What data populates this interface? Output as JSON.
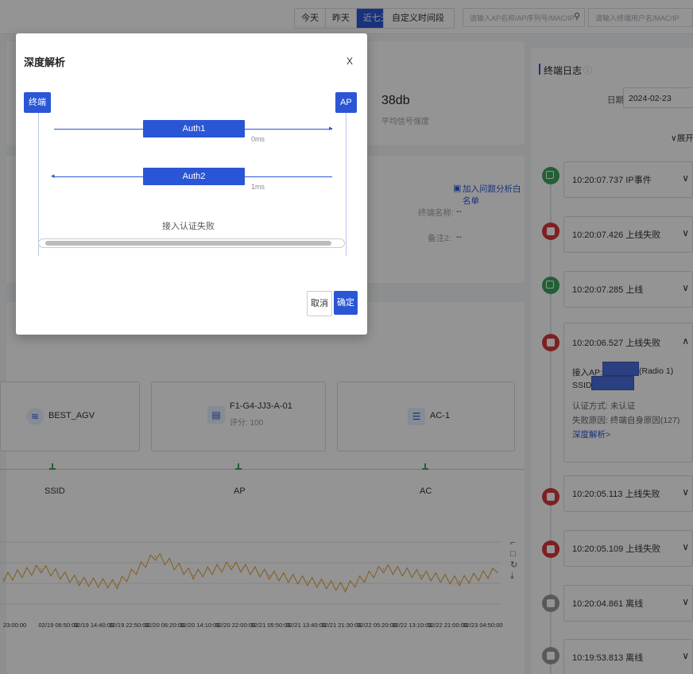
{
  "topbar": {
    "date_ranges": [
      "今天",
      "昨天",
      "近七天"
    ],
    "active_range": "近七天",
    "custom_range_label": "自定义时间段",
    "ap_search_placeholder": "请输入AP名称/AP序列号/MAC/IP",
    "user_search_placeholder": "请输入终端用户名/MAC/IP"
  },
  "summary": {
    "signal_value": "38db",
    "signal_label": "平均信号强度"
  },
  "detail_card": {
    "add_whitelist_label": "加入问题分析白名单",
    "terminal_name_label": "终端名称:",
    "terminal_name_value": "--",
    "note_label": "备注2:",
    "note_value": "--"
  },
  "topology": {
    "nodes": [
      {
        "name": "BEST_AGV",
        "sub": ""
      },
      {
        "name": "F1-G4-JJ3-A-01",
        "sub": "评分: 100"
      },
      {
        "name": "AC-1",
        "sub": ""
      }
    ],
    "labels": [
      "SSID",
      "AP",
      "AC"
    ]
  },
  "chart_data": {
    "type": "line",
    "title": "",
    "x": [
      "23:00:00",
      "02/19 06:50:00",
      "02/19 14:40:00",
      "02/19 22:50:00",
      "02/20 06:20:00",
      "02/20 14:10:00",
      "02/20 22:00:00",
      "02/21 05:50:00",
      "02/21 13:40:00",
      "02/21 21:30:00",
      "02/22 05:20:00",
      "02/22 13:10:00",
      "02/22 21:00:00",
      "02/23 04:50:00"
    ],
    "series": [
      {
        "color": "#e3a12d",
        "values": [
          0.4,
          0.55,
          0.35,
          0.3,
          0.75,
          0.45,
          0.6,
          0.45,
          0.35,
          0.25,
          0.55,
          0.45,
          0.35,
          0.5
        ]
      }
    ],
    "grid": true,
    "legend": "none",
    "tools": [
      "crop-icon",
      "restore-icon",
      "refresh-icon",
      "download-icon"
    ]
  },
  "log": {
    "title": "终端日志",
    "date_label": "日期",
    "date_value": "2024-02-23",
    "expand_all": "展开全",
    "items": [
      {
        "time": "10:20:07.737",
        "event": "IP事件",
        "color": "#3ca45c",
        "expanded": false
      },
      {
        "time": "10:20:07.426",
        "event": "上线失败",
        "color": "#d9373a",
        "expanded": false
      },
      {
        "time": "10:20:07.285",
        "event": "上线",
        "color": "#3ca45c",
        "expanded": false
      },
      {
        "time": "10:20:06.527",
        "event": "上线失败",
        "color": "#d9373a",
        "expanded": true
      },
      {
        "time": "10:20:05.113",
        "event": "上线失败",
        "color": "#d9373a",
        "expanded": false
      },
      {
        "time": "10:20:05.109",
        "event": "上线失败",
        "color": "#d9373a",
        "expanded": false
      },
      {
        "time": "10:20:04.861",
        "event": "离线",
        "color": "#9a9a9a",
        "expanded": false
      },
      {
        "time": "10:19:53.813",
        "event": "离线",
        "color": "#9a9a9a",
        "expanded": false
      }
    ],
    "expanded_detail": {
      "ap_label": "接入AP:",
      "radio": "(Radio 1)",
      "ssid_label": "SSID:",
      "auth_label": "认证方式: 未认证",
      "fail_label": "失败原因: 终端自身原因(127)",
      "deep_link": "深度解析>"
    }
  },
  "modal": {
    "title": "深度解析",
    "close": "X",
    "left_tag": "终端",
    "right_tag": "AP",
    "auth1": "Auth1",
    "auth1_time": "0ms",
    "auth2": "Auth2",
    "auth2_time": "1ms",
    "result": "接入认证失败",
    "cancel": "取消",
    "confirm": "确定"
  }
}
